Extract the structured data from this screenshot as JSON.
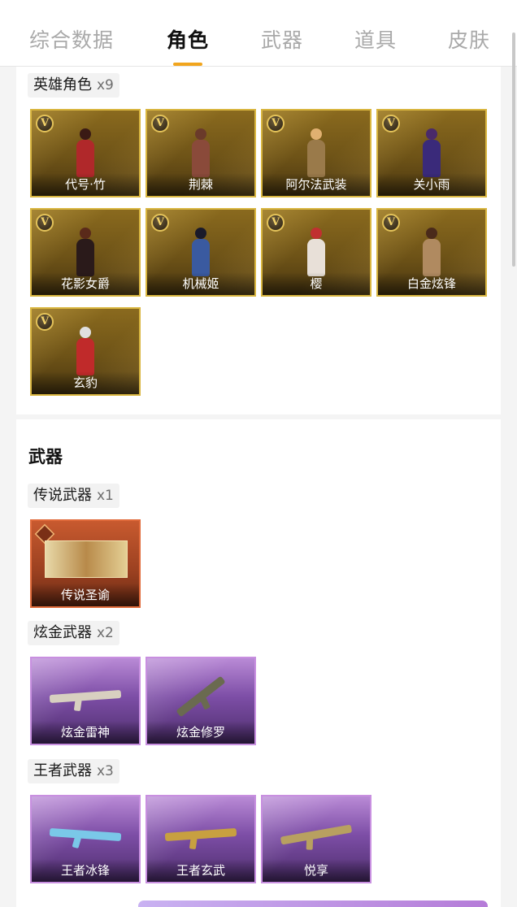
{
  "tabs": [
    {
      "label": "综合数据",
      "active": false
    },
    {
      "label": "角色",
      "active": true
    },
    {
      "label": "武器",
      "active": false
    },
    {
      "label": "道具",
      "active": false
    },
    {
      "label": "皮肤",
      "active": false
    }
  ],
  "heroes": {
    "group_label": "英雄角色",
    "count": "x9",
    "badge_letter": "V",
    "items": [
      {
        "name": "代号·竹"
      },
      {
        "name": "荆棘"
      },
      {
        "name": "阿尔法武装"
      },
      {
        "name": "关小雨"
      },
      {
        "name": "花影女爵"
      },
      {
        "name": "机械姬"
      },
      {
        "name": "樱"
      },
      {
        "name": "白金炫锋"
      },
      {
        "name": "玄豹"
      }
    ]
  },
  "weapons": {
    "section_title": "武器",
    "groups": [
      {
        "label": "传说武器",
        "count": "x1",
        "items": [
          {
            "name": "传说圣谕"
          }
        ]
      },
      {
        "label": "炫金武器",
        "count": "x2",
        "items": [
          {
            "name": "炫金雷神"
          },
          {
            "name": "炫金修罗"
          }
        ]
      },
      {
        "label": "王者武器",
        "count": "x3",
        "items": [
          {
            "name": "王者冰锋"
          },
          {
            "name": "王者玄武"
          },
          {
            "name": "悦享"
          }
        ]
      }
    ]
  },
  "colors": {
    "accent": "#f1a51d",
    "gold_border": "#d9b640",
    "legend_border": "#e06a3a",
    "purple_border": "#c88fe0"
  }
}
